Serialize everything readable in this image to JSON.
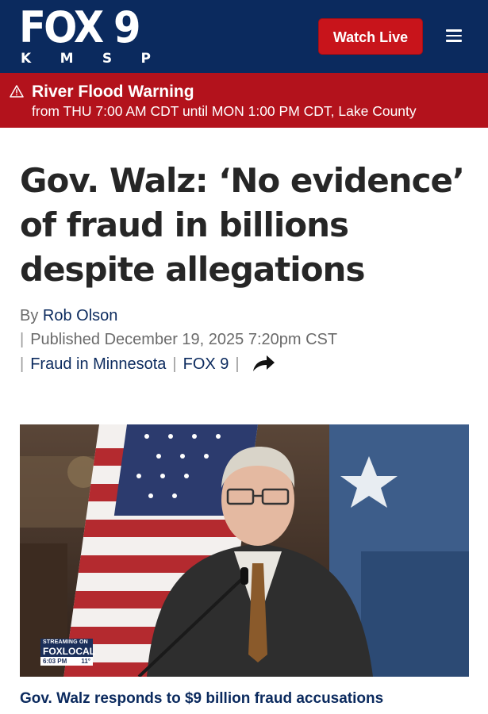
{
  "header": {
    "logo_main": "FOX 9",
    "logo_letters": [
      "K",
      "M",
      "S",
      "P"
    ],
    "watch_live_label": "Watch Live",
    "menu_icon": "hamburger-menu-icon",
    "background_color": "#0b2a5e"
  },
  "alert": {
    "icon": "warning-triangle-icon",
    "title": "River Flood Warning",
    "detail": "from THU 7:00 AM CDT until MON 1:00 PM CDT, Lake County",
    "background_color": "#b3121c"
  },
  "article": {
    "headline": "Gov. Walz: ‘No evidence’ of fraud in billions despite allegations",
    "byline_prefix": "By",
    "author": "Rob Olson",
    "published_label": "Published",
    "published_date": "December 19, 2025 7:20pm CST",
    "topic": "Fraud in Minnesota",
    "source": "FOX 9",
    "share_icon": "share-arrow-icon"
  },
  "media": {
    "bug_top": "STREAMING ON",
    "bug_brand": "FOXLOCAL",
    "bug_time": "6:03 PM",
    "bug_temp": "11°",
    "caption": "Gov. Walz responds to $9 billion fraud accusations"
  },
  "colors": {
    "link": "#0b2a5e",
    "accent_red": "#c8141b"
  }
}
